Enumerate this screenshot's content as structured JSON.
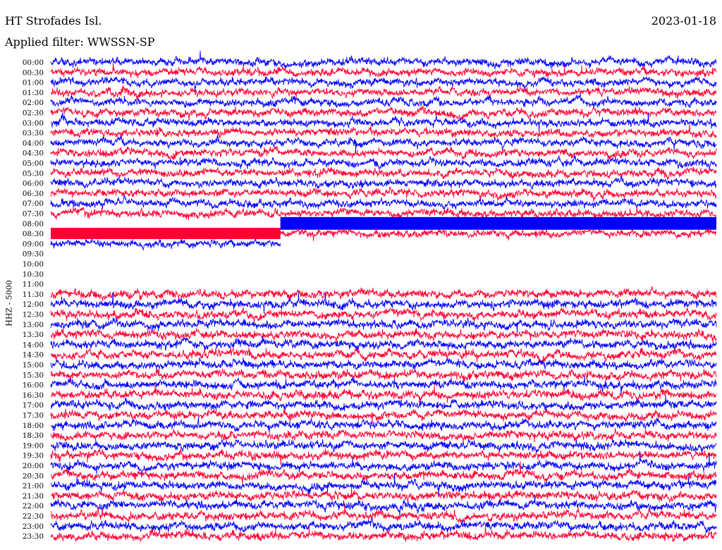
{
  "header": {
    "station": "HT Strofades Isl.",
    "filter": "Applied filter: WWSSN-SP",
    "date": "2023-01-18"
  },
  "chart_data": {
    "type": "line",
    "subtype": "helicorder",
    "title": "HT Strofades Isl.",
    "date": "2023-01-18",
    "ylabel": "HHZ - 5000",
    "xlabel": "",
    "tick_labels": [
      "00:00",
      "00:30",
      "01:00",
      "01:30",
      "02:00",
      "02:30",
      "03:00",
      "03:30",
      "04:00",
      "04:30",
      "05:00",
      "05:30",
      "06:00",
      "06:30",
      "07:00",
      "07:30",
      "08:00",
      "08:30",
      "09:00",
      "09:30",
      "10:00",
      "10:30",
      "11:00",
      "11:30",
      "12:00",
      "12:30",
      "13:00",
      "13:30",
      "14:00",
      "14:30",
      "15:00",
      "15:30",
      "16:00",
      "16:30",
      "17:00",
      "17:30",
      "18:00",
      "18:30",
      "19:00",
      "19:30",
      "20:00",
      "20:30",
      "21:00",
      "21:30",
      "22:00",
      "22:30",
      "23:00",
      "23:30"
    ],
    "row_minutes": 30,
    "line_colors": [
      "#0000ff",
      "#ff0033"
    ],
    "gaps": [
      {
        "start": "08:00",
        "end": "08:30",
        "from_fraction": 0.0,
        "to_fraction": 0.345,
        "note": "data gap in 08:00 line"
      },
      {
        "start": "09:00",
        "end": "11:30",
        "note": "no data (quiet / gap)"
      }
    ],
    "grid": false
  }
}
